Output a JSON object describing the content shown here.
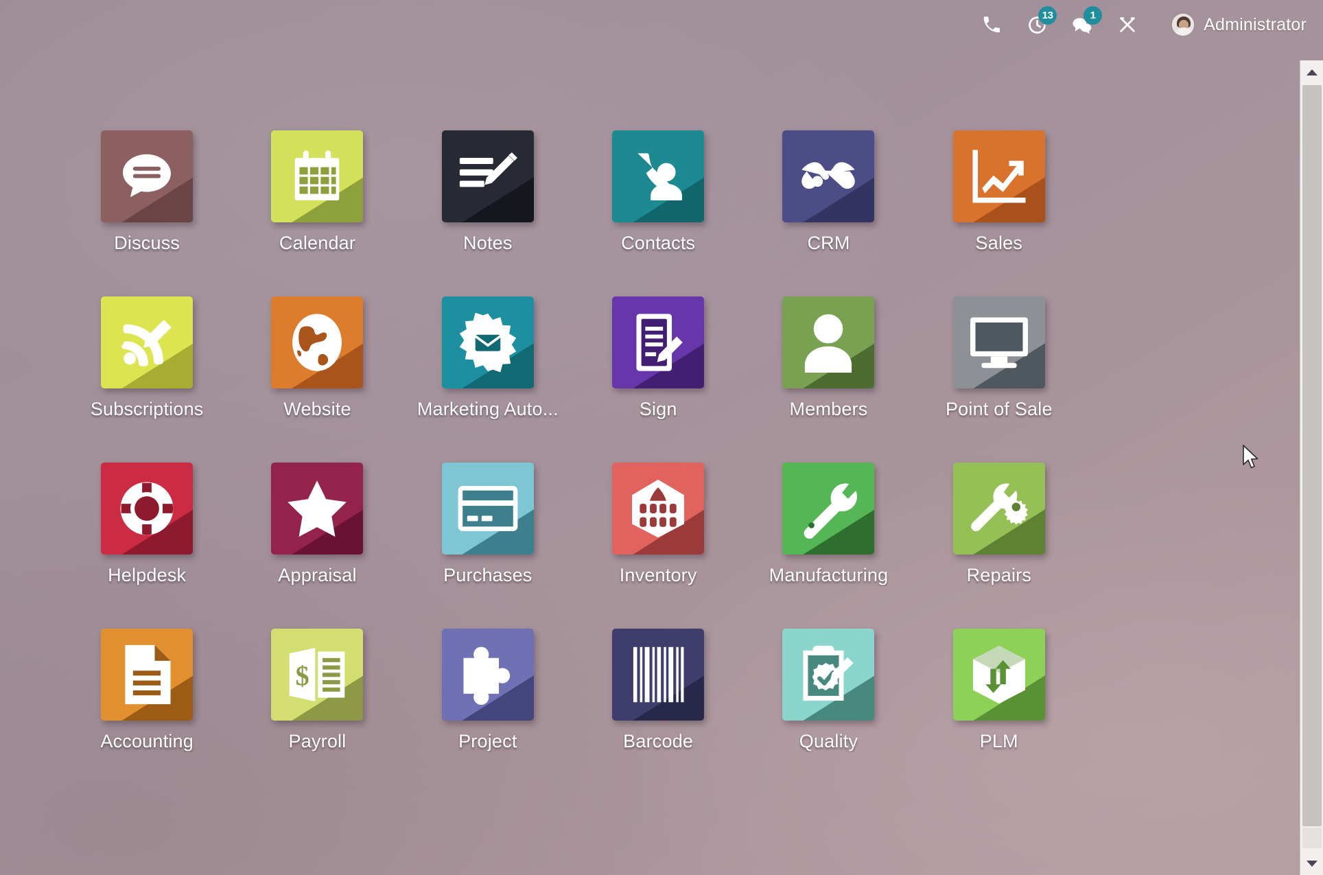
{
  "topbar": {
    "phone_icon": "phone-icon",
    "activity": {
      "icon": "clock-activity-icon",
      "badge": "13"
    },
    "messages": {
      "icon": "message-bubble-icon",
      "badge": "1"
    },
    "tools_icon": "tools-icon",
    "user": {
      "name": "Administrator",
      "avatar": "user-avatar"
    }
  },
  "scrollbar": {
    "up_arrow": "scroll-up-arrow",
    "down_arrow": "scroll-down-arrow"
  },
  "apps": [
    {
      "label": "Discuss",
      "icon": "speech-bubble-icon",
      "bg": "#8c5f60",
      "shadow": "#6b4546"
    },
    {
      "label": "Calendar",
      "icon": "calendar-icon",
      "bg": "#d3e05b",
      "shadow": "#8ea03c"
    },
    {
      "label": "Notes",
      "icon": "note-pencil-icon",
      "bg": "#272a35",
      "shadow": "#15171e"
    },
    {
      "label": "Contacts",
      "icon": "phone-person-icon",
      "bg": "#1d8a91",
      "shadow": "#11666c"
    },
    {
      "label": "CRM",
      "icon": "handshake-icon",
      "bg": "#4c4c86",
      "shadow": "#343463"
    },
    {
      "label": "Sales",
      "icon": "chart-up-icon",
      "bg": "#d9722c",
      "shadow": "#a8511a"
    },
    {
      "label": "Subscriptions",
      "icon": "rss-pencil-icon",
      "bg": "#dce44f",
      "shadow": "#a6ad32"
    },
    {
      "label": "Website",
      "icon": "globe-icon",
      "bg": "#dd7c2c",
      "shadow": "#a8541a"
    },
    {
      "label": "Marketing Auto...",
      "icon": "gear-envelope-icon",
      "bg": "#1c8fa0",
      "shadow": "#116974"
    },
    {
      "label": "Sign",
      "icon": "document-pen-icon",
      "bg": "#6736ab",
      "shadow": "#431f74"
    },
    {
      "label": "Members",
      "icon": "person-icon",
      "bg": "#79a152",
      "shadow": "#4d6d30"
    },
    {
      "label": "Point of Sale",
      "icon": "monitor-icon",
      "bg": "#8d9195",
      "shadow": "#4e585e"
    },
    {
      "label": "Helpdesk",
      "icon": "life-ring-icon",
      "bg": "#cc2b44",
      "shadow": "#8f1a2e"
    },
    {
      "label": "Appraisal",
      "icon": "star-icon",
      "bg": "#93234a",
      "shadow": "#6a1234"
    },
    {
      "label": "Purchases",
      "icon": "credit-card-icon",
      "bg": "#7fc6d4",
      "shadow": "#3d7f8c"
    },
    {
      "label": "Inventory",
      "icon": "warehouse-icon",
      "bg": "#e0635e",
      "shadow": "#9b3a3a"
    },
    {
      "label": "Manufacturing",
      "icon": "wrench-icon",
      "bg": "#55b656",
      "shadow": "#2e6f2f"
    },
    {
      "label": "Repairs",
      "icon": "wrench-gear-icon",
      "bg": "#94c056",
      "shadow": "#5f8133"
    },
    {
      "label": "Accounting",
      "icon": "invoice-doc-icon",
      "bg": "#e2902f",
      "shadow": "#9d5c16"
    },
    {
      "label": "Payroll",
      "icon": "payslip-dollar-icon",
      "bg": "#d2de70",
      "shadow": "#8d9945"
    },
    {
      "label": "Project",
      "icon": "puzzle-piece-icon",
      "bg": "#6f71b4",
      "shadow": "#43457d"
    },
    {
      "label": "Barcode",
      "icon": "barcode-icon",
      "bg": "#3e3d6b",
      "shadow": "#28284a"
    },
    {
      "label": "Quality",
      "icon": "clipboard-check-icon",
      "bg": "#8ad6cd",
      "shadow": "#48897f"
    },
    {
      "label": "PLM",
      "icon": "box-arrows-icon",
      "bg": "#8ed158",
      "shadow": "#5a9134"
    }
  ]
}
